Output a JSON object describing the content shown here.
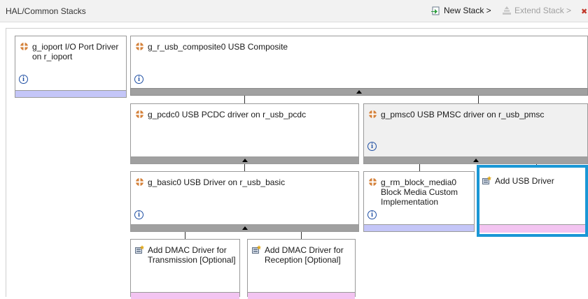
{
  "header": {
    "title": "HAL/Common Stacks",
    "new_stack": "New Stack >",
    "extend_stack": "Extend Stack >"
  },
  "colors": {
    "selection": "#1a97d5",
    "bar_lavender": "#c4c6f8",
    "bar_grey": "#a0a0a0",
    "bar_pink": "#f3c4f1",
    "module_icon": "#d4813a"
  },
  "modules": {
    "ioport": {
      "title": "g_ioport I/O Port Driver on r_ioport",
      "icon": "module-icon",
      "info": "i"
    },
    "usb_composite": {
      "title": "g_r_usb_composite0 USB Composite",
      "icon": "module-icon",
      "info": "i"
    },
    "pcdc": {
      "title": "g_pcdc0 USB PCDC driver on r_usb_pcdc",
      "icon": "module-icon"
    },
    "pmsc": {
      "title": "g_pmsc0 USB PMSC driver on r_usb_pmsc",
      "icon": "module-icon",
      "info": "i"
    },
    "basic": {
      "title": "g_basic0 USB Driver on r_usb_basic",
      "icon": "module-icon",
      "info": "i"
    },
    "block_media": {
      "title": "g_rm_block_media0 Block Media Custom Implementation",
      "icon": "module-icon",
      "info": "i"
    },
    "add_usb": {
      "title": "Add USB Driver",
      "icon": "add-driver-icon"
    },
    "add_dmac_tx": {
      "title": "Add DMAC Driver for Transmission [Optional]",
      "icon": "add-driver-icon"
    },
    "add_dmac_rx": {
      "title": "Add DMAC Driver for Reception [Optional]",
      "icon": "add-driver-icon"
    }
  }
}
